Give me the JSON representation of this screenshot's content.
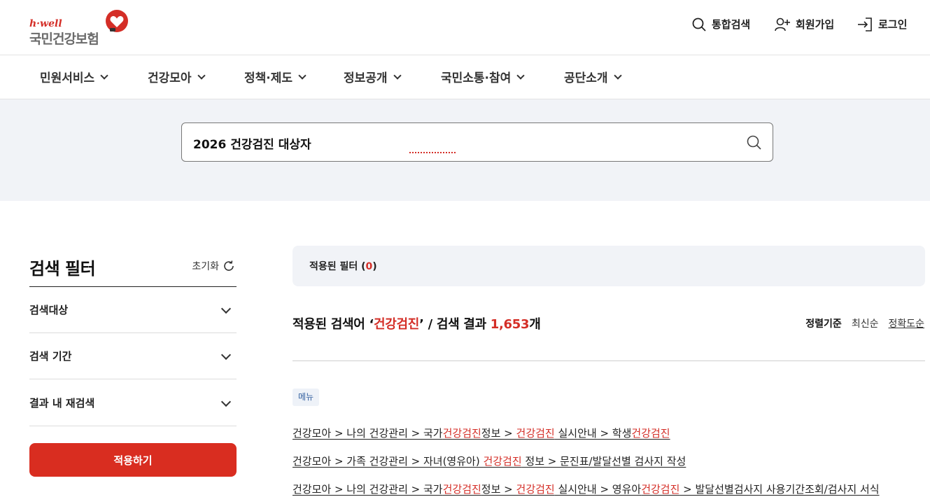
{
  "brand": {
    "hwell": "h·well",
    "name": "국민건강보험",
    "accent": "#d42e27"
  },
  "utility": {
    "search": "통합검색",
    "join": "회원가입",
    "login": "로그인"
  },
  "gnb": [
    "민원서비스",
    "건강모아",
    "정책·제도",
    "정보공개",
    "국민소통·참여",
    "공단소개"
  ],
  "search": {
    "value": "2026 건강검진 대상자"
  },
  "filter": {
    "title": "검색 필터",
    "reset": "초기화",
    "rows": [
      "검색대상",
      "검색 기간",
      "결과 내 재검색"
    ],
    "apply": "적용하기"
  },
  "applied": {
    "label": "적용된 필터 (",
    "count": "0",
    "close": ")"
  },
  "summary": {
    "prefix": "적용된 검색어 ‘",
    "keyword": "건강검진",
    "middle": "’ / 검색 결과 ",
    "count": "1,653",
    "suffix": "개"
  },
  "sort": {
    "label": "정렬기준",
    "latest": "최신순",
    "accuracy": "정확도순"
  },
  "category_tag": "메뉴",
  "results": [
    [
      "건강모아 > 나의 건강관리 > 국가",
      "건강검진",
      "정보 > ",
      "건강검진",
      " 실시안내 > 학생",
      "건강검진",
      ""
    ],
    [
      "건강모아 > 가족 건강관리 > 자녀(영유아) ",
      "건강검진",
      " 정보 > 문진표/발달선별 검사지 작성",
      "",
      "",
      "",
      ""
    ],
    [
      "건강모아 > 나의 건강관리 > 국가",
      "건강검진",
      "정보 > ",
      "건강검진",
      " 실시안내 > 영유아",
      "건강검진",
      " > 발달선별검사지 사용기간조회/검사지 서식"
    ]
  ]
}
